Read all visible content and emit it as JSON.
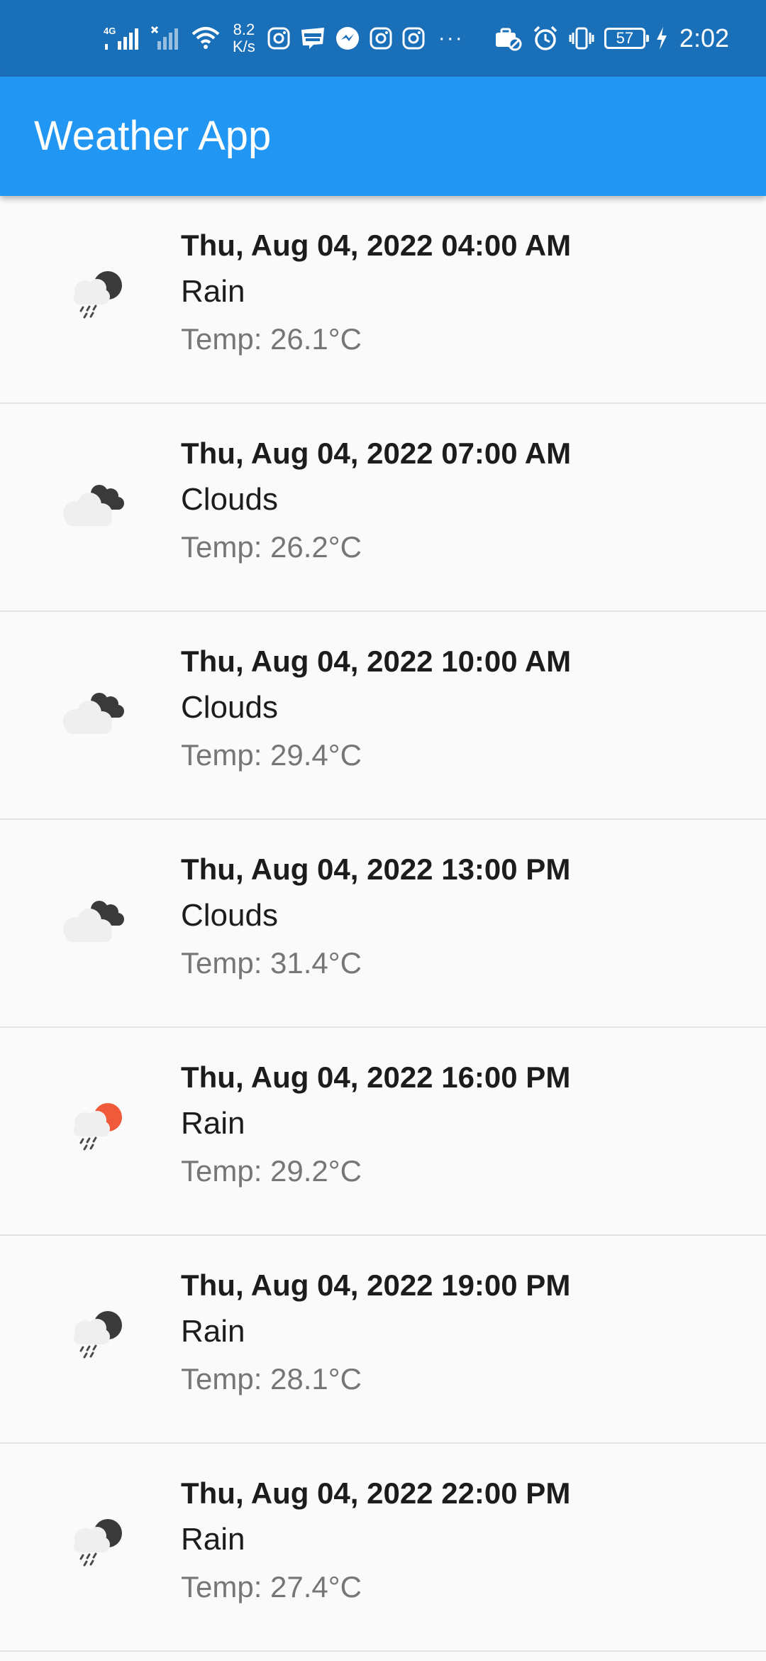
{
  "status_bar": {
    "network_type": "4G",
    "net_speed_value": "8.2",
    "net_speed_unit": "K/s",
    "more_indicator": "···",
    "battery_level": "57",
    "time": "2:02",
    "icons": [
      "signal-icon",
      "no-signal-icon",
      "wifi-icon",
      "instagram-icon",
      "webtoon-icon",
      "messenger-icon",
      "instagram-icon",
      "instagram-icon",
      "work-profile-icon",
      "alarm-icon",
      "vibrate-icon",
      "battery-icon",
      "charging-icon"
    ]
  },
  "app_bar": {
    "title": "Weather App",
    "color": "#2196f3"
  },
  "forecast": [
    {
      "date": "Thu, Aug 04, 2022 04:00 AM",
      "condition": "Rain",
      "temp": "Temp: 26.1°C",
      "icon": "rain-night-icon"
    },
    {
      "date": "Thu, Aug 04, 2022 07:00 AM",
      "condition": "Clouds",
      "temp": "Temp: 26.2°C",
      "icon": "clouds-icon"
    },
    {
      "date": "Thu, Aug 04, 2022 10:00 AM",
      "condition": "Clouds",
      "temp": "Temp: 29.4°C",
      "icon": "clouds-icon"
    },
    {
      "date": "Thu, Aug 04, 2022 13:00 PM",
      "condition": "Clouds",
      "temp": "Temp: 31.4°C",
      "icon": "clouds-icon"
    },
    {
      "date": "Thu, Aug 04, 2022 16:00 PM",
      "condition": "Rain",
      "temp": "Temp: 29.2°C",
      "icon": "rain-day-icon"
    },
    {
      "date": "Thu, Aug 04, 2022 19:00 PM",
      "condition": "Rain",
      "temp": "Temp: 28.1°C",
      "icon": "rain-night-icon"
    },
    {
      "date": "Thu, Aug 04, 2022 22:00 PM",
      "condition": "Rain",
      "temp": "Temp: 27.4°C",
      "icon": "rain-night-icon"
    }
  ]
}
